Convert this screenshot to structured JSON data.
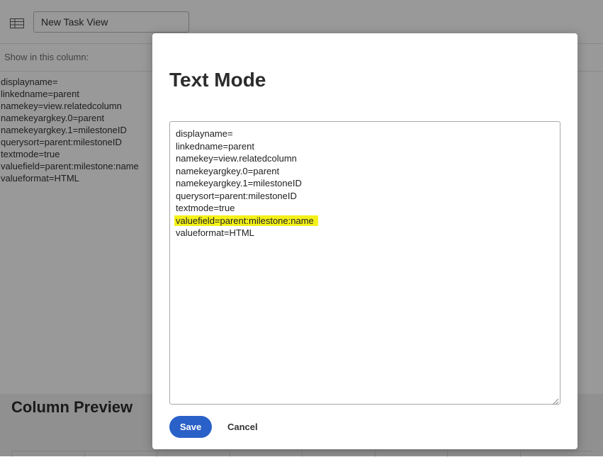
{
  "app": {
    "view_name": "New Task View",
    "show_label": "Show in this column:",
    "column_lines": [
      "displayname=",
      "linkedname=parent",
      "namekey=view.relatedcolumn",
      "namekeyargkey.0=parent",
      "namekeyargkey.1=milestoneID",
      "querysort=parent:milestoneID",
      "textmode=true",
      "valuefield=parent:milestone:name",
      "valueformat=HTML"
    ],
    "preview_title": "Column Preview",
    "icons": {
      "view_type": "table-grid-icon"
    }
  },
  "modal": {
    "title": "Text Mode",
    "editor_lines": [
      "displayname=",
      "linkedname=parent",
      "namekey=view.relatedcolumn",
      "namekeyargkey.0=parent",
      "namekeyargkey.1=milestoneID",
      "querysort=parent:milestoneID",
      "textmode=true",
      "valuefield=parent:milestone:name",
      "valueformat=HTML"
    ],
    "highlighted_line_index": 7,
    "save_label": "Save",
    "cancel_label": "Cancel"
  },
  "colors": {
    "primary_button": "#2a61c8",
    "highlight": "#f4f11a",
    "overlay": "rgba(0,0,0,0.40)"
  }
}
